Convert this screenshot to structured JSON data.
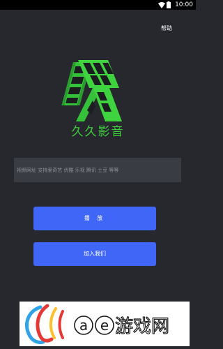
{
  "status_bar": {
    "time": "10:00",
    "icons": [
      "wifi-icon",
      "battery-icon"
    ]
  },
  "header": {
    "help_label": "帮助"
  },
  "app": {
    "name": "久久影音",
    "brand_color": "#3fcf3d"
  },
  "url_input": {
    "placeholder": "视频网址 支持爱奇艺 优酷 乐视 腾讯 土豆 等等",
    "value": ""
  },
  "buttons": {
    "play_label": "播 放",
    "join_label": "加入我们",
    "accent_color": "#3f66f7"
  },
  "watermark": {
    "text": "ae游戏网"
  }
}
